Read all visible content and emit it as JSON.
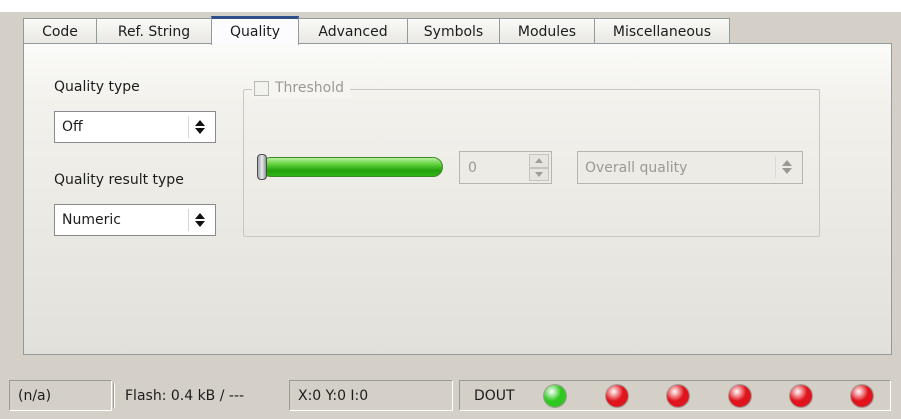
{
  "tabs": [
    {
      "label": "Code",
      "active": false
    },
    {
      "label": "Ref. String",
      "active": false
    },
    {
      "label": "Quality",
      "active": true
    },
    {
      "label": "Advanced",
      "active": false
    },
    {
      "label": "Symbols",
      "active": false
    },
    {
      "label": "Modules",
      "active": false
    },
    {
      "label": "Miscellaneous",
      "active": false
    }
  ],
  "quality": {
    "quality_type_label": "Quality type",
    "quality_type_value": "Off",
    "quality_result_type_label": "Quality result type",
    "quality_result_type_value": "Numeric"
  },
  "threshold": {
    "label": "Threshold",
    "checked": false,
    "enabled": false,
    "slider_value_fraction": 0.0,
    "spin_value": "0",
    "mode_value": "Overall quality"
  },
  "statusbar": {
    "status": "(n/a)",
    "flash": "Flash:  0.4 kB / ---",
    "coords": "X:0 Y:0 I:0",
    "dout_label": "DOUT",
    "leds": [
      {
        "name": "dout-led-1",
        "state": "on",
        "color": "#2ec81e"
      },
      {
        "name": "dout-led-2",
        "state": "off",
        "color": "#e0141c"
      },
      {
        "name": "dout-led-3",
        "state": "off",
        "color": "#e0141c"
      },
      {
        "name": "dout-led-4",
        "state": "off",
        "color": "#e0141c"
      },
      {
        "name": "dout-led-5",
        "state": "off",
        "color": "#e0141c"
      },
      {
        "name": "dout-led-6",
        "state": "off",
        "color": "#e0141c"
      }
    ]
  },
  "colors": {
    "active_tab_accent": "#2d4f8a",
    "slider_green": "#2fb514",
    "led_green": "#2ec81e",
    "led_red": "#e0141c"
  },
  "icons": [
    "checkbox-icon",
    "updown-arrows-icon",
    "spin-up-icon",
    "spin-down-icon",
    "led-icon"
  ]
}
